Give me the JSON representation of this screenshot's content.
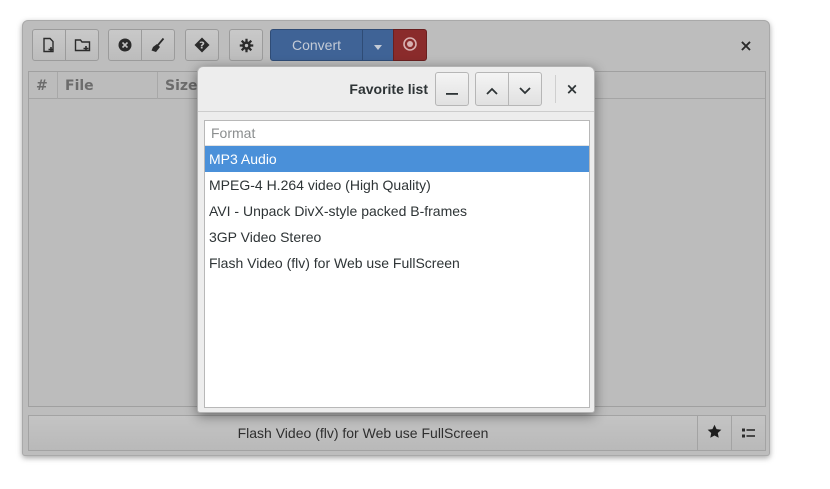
{
  "main_window": {
    "toolbar": {
      "add_file_icon": "file-add-icon",
      "add_folder_icon": "folder-add-icon",
      "remove_icon": "remove-circle-icon",
      "clear_icon": "broom-icon",
      "help_icon": "help-diamond-icon",
      "settings_icon": "gear-icon",
      "convert_label": "Convert",
      "convert_dropdown_icon": "chevron-down-icon",
      "stop_icon": "record-stop-icon",
      "close_label": "×"
    },
    "columns": [
      "#",
      "File",
      "Size"
    ],
    "status_bar": {
      "selected_format": "Flash Video (flv) for Web use FullScreen",
      "favorite_icon": "star-icon",
      "list_icon": "list-icon"
    }
  },
  "dialog": {
    "title": "Favorite list",
    "remove_label": "–",
    "close_label": "×",
    "format_header": "Format",
    "formats": [
      {
        "label": "MP3 Audio",
        "selected": true
      },
      {
        "label": "MPEG-4 H.264 video (High Quality)",
        "selected": false
      },
      {
        "label": "AVI - Unpack DivX-style packed B-frames",
        "selected": false
      },
      {
        "label": "3GP Video Stereo",
        "selected": false
      },
      {
        "label": "Flash Video (flv) for Web use FullScreen",
        "selected": false
      }
    ]
  },
  "colors": {
    "selection": "#4a90d9",
    "convert_button": "#3f6396",
    "stop_button": "#8a2b2b"
  }
}
